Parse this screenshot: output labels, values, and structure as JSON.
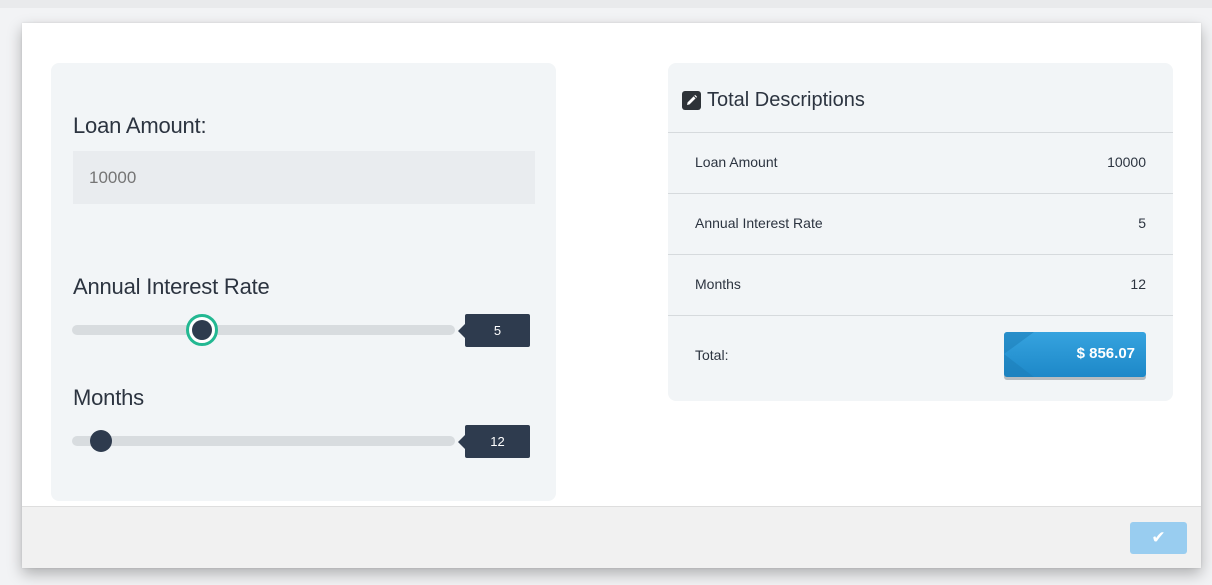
{
  "form": {
    "loan_amount_label": "Loan Amount:",
    "loan_amount_placeholder": "10000",
    "interest_rate_label": "Annual Interest Rate",
    "interest_rate_value": "5",
    "months_label": "Months",
    "months_value": "12"
  },
  "sliders": {
    "interest_rate_fraction": 0.34,
    "months_fraction": 0.08
  },
  "summary": {
    "title": "Total Descriptions",
    "title_icon": "edit-icon",
    "rows": [
      {
        "label": "Loan Amount",
        "value": "10000"
      },
      {
        "label": "Annual Interest Rate",
        "value": "5"
      },
      {
        "label": "Months",
        "value": "12"
      }
    ],
    "total_label": "Total:",
    "total_value": "$ 856.07"
  },
  "footer": {
    "confirm_icon": "check-icon"
  },
  "colors": {
    "accent_green": "#23b892",
    "dark_navy": "#2e3b4e",
    "total_blue": "#2a95d6",
    "confirm_blue": "#99cdf0"
  }
}
